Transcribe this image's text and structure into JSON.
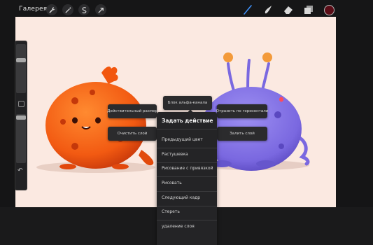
{
  "topbar": {
    "gallery_label": "Галерея",
    "tools_left": [
      "wrench-icon",
      "magic-wand-icon",
      "selection-icon",
      "transform-arrow-icon"
    ],
    "tools_right": [
      "brush-icon",
      "smudge-icon",
      "eraser-icon",
      "layers-icon"
    ],
    "current_color": "#5a0c16"
  },
  "gesture_options": {
    "alpha_lock": "Блок альфа-канала",
    "actual_size": "Действительный размер",
    "flip_horizontal": "Отразить по горизонтали",
    "clear_layer": "Очистить слой",
    "fill_layer": "Залить слой"
  },
  "action_menu": {
    "title": "Задать действие",
    "items": [
      "Предыдущий цвет",
      "Растушевка",
      "Рисование с привязкой",
      "Рисовать",
      "Следующий кадр",
      "Стереть",
      "удаление слоя"
    ]
  },
  "colors": {
    "canvas_bg": "#fbe9e1",
    "accent": "#3f8ff5",
    "orange_monster": "#f25a12",
    "purple_monster": "#7a68e0"
  }
}
